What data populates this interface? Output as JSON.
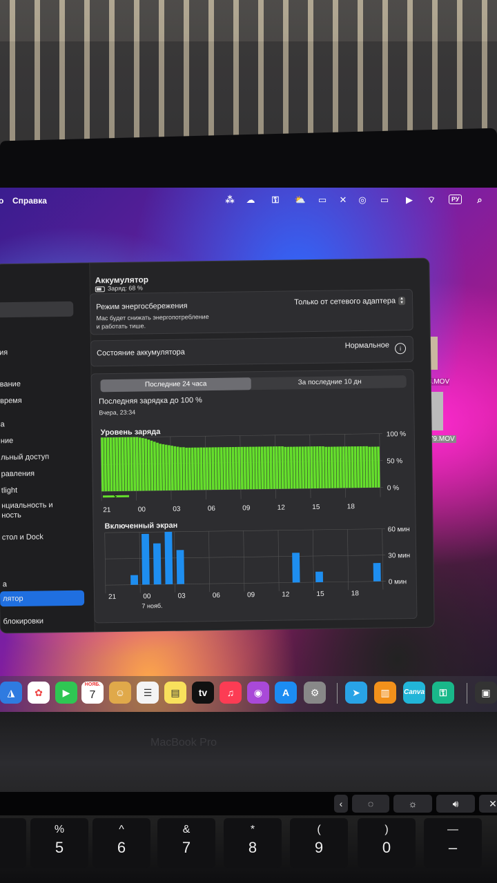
{
  "menubar": {
    "left_fragment": "о",
    "help": "Справка",
    "input_source": "РУ"
  },
  "sidebar": {
    "items": [
      {
        "label": "ия"
      },
      {
        "label": "вание"
      },
      {
        "label": "время"
      },
      {
        "label": "а"
      },
      {
        "label": "ние"
      },
      {
        "label": "льный доступ"
      },
      {
        "label": "равления"
      },
      {
        "label": "tlight"
      },
      {
        "label": "нциальность и"
      },
      {
        "label": "ность"
      },
      {
        "label": "стол и Dock"
      },
      {
        "label": "а"
      },
      {
        "label": "лятор"
      },
      {
        "label": "блокировки"
      }
    ]
  },
  "battery": {
    "title": "Аккумулятор",
    "charge": "Заряд: 68 %",
    "low_power_mode_label": "Режим энергосбережения",
    "low_power_mode_desc_line1": "Mac будет снижать энергопотребление",
    "low_power_mode_desc_line2": "и работать тише.",
    "low_power_mode_value": "Только от сетевого адаптера",
    "health_label": "Состояние аккумулятора",
    "health_value": "Нормальное",
    "tabs": {
      "last24": "Последние 24 часа",
      "last10": "За последние 10 дн"
    },
    "last_charge_label": "Последняя зарядка до 100 %",
    "last_charge_time": "Вчера, 23:34"
  },
  "desktop": {
    "file1": "8.MOV",
    "file2": "79.MOV"
  },
  "dock": {
    "calendar_month": "НОЯБ.",
    "calendar_day": "7",
    "appletv_label": "tv",
    "canva_label": "Canva"
  },
  "hardware": {
    "brand": "MacBook Pro"
  },
  "keyboard": [
    {
      "top": "%",
      "bottom": "5"
    },
    {
      "top": "^",
      "bottom": "6"
    },
    {
      "top": "&",
      "bottom": "7"
    },
    {
      "top": "*",
      "bottom": "8"
    },
    {
      "top": "(",
      "bottom": "9"
    },
    {
      "top": ")",
      "bottom": "0"
    },
    {
      "top": "—",
      "bottom": "–"
    }
  ],
  "colors": {
    "selection": "#1f6fe0",
    "battery_bar": "#65e02c",
    "screen_bar": "#1e8ef0"
  },
  "chart_data": [
    {
      "type": "bar",
      "title": "Уровень заряда",
      "categories": [
        "21",
        "00",
        "03",
        "06",
        "09",
        "12",
        "15",
        "18"
      ],
      "series": [
        {
          "values": [
            1.0,
            1.0,
            1.0,
            1.0,
            1.0,
            1.0,
            1.0,
            1.0,
            1.0,
            1.0,
            1.0,
            1.0,
            1.0,
            0.99,
            0.98,
            0.97,
            0.95,
            0.93,
            0.91,
            0.89,
            0.87,
            0.86,
            0.85,
            0.84,
            0.83,
            0.82,
            0.81,
            0.8,
            0.8,
            0.79,
            0.79,
            0.79,
            0.79,
            0.79,
            0.79,
            0.79,
            0.79,
            0.79,
            0.79,
            0.79,
            0.79,
            0.79,
            0.79,
            0.79,
            0.79,
            0.79,
            0.79,
            0.79,
            0.79,
            0.79,
            0.79,
            0.79,
            0.79,
            0.79,
            0.79,
            0.79,
            0.79,
            0.79,
            0.79,
            0.79,
            0.79,
            0.79,
            0.79,
            0.78,
            0.78,
            0.78,
            0.78,
            0.78,
            0.78,
            0.78,
            0.78,
            0.78,
            0.78,
            0.78,
            0.78,
            0.78,
            0.78,
            0.77,
            0.77,
            0.77,
            0.77,
            0.77,
            0.77,
            0.77,
            0.77,
            0.77,
            0.77,
            0.77,
            0.77,
            0.77,
            0.77,
            0.77,
            0.76,
            0.76,
            0.76,
            0.76
          ]
        }
      ],
      "y_ticks": [
        "100 %",
        "50 %",
        "0 %"
      ],
      "ylim": [
        0,
        100
      ],
      "grid": true
    },
    {
      "type": "bar",
      "title": "Включенный экран",
      "categories": [
        "21",
        "00",
        "03",
        "06",
        "09",
        "12",
        "15",
        "18"
      ],
      "x_sublabel": "7 нояб.",
      "series": [
        {
          "values": [
            0,
            0,
            0,
            0,
            0,
            0,
            0,
            0,
            0,
            0,
            0,
            0,
            0,
            0,
            0,
            0,
            0,
            0,
            0,
            0,
            0,
            0,
            0,
            0
          ]
        }
      ],
      "bars": [
        {
          "slot": 2,
          "minutes": 11
        },
        {
          "slot": 3,
          "minutes": 58
        },
        {
          "slot": 4,
          "minutes": 47
        },
        {
          "slot": 5,
          "minutes": 60
        },
        {
          "slot": 6,
          "minutes": 39
        },
        {
          "slot": 16,
          "minutes": 34
        },
        {
          "slot": 18,
          "minutes": 12
        },
        {
          "slot": 23,
          "minutes": 21
        }
      ],
      "y_ticks": [
        "60 мин",
        "30 мин",
        "0 мин"
      ],
      "ylim": [
        0,
        60
      ],
      "grid": true
    }
  ]
}
